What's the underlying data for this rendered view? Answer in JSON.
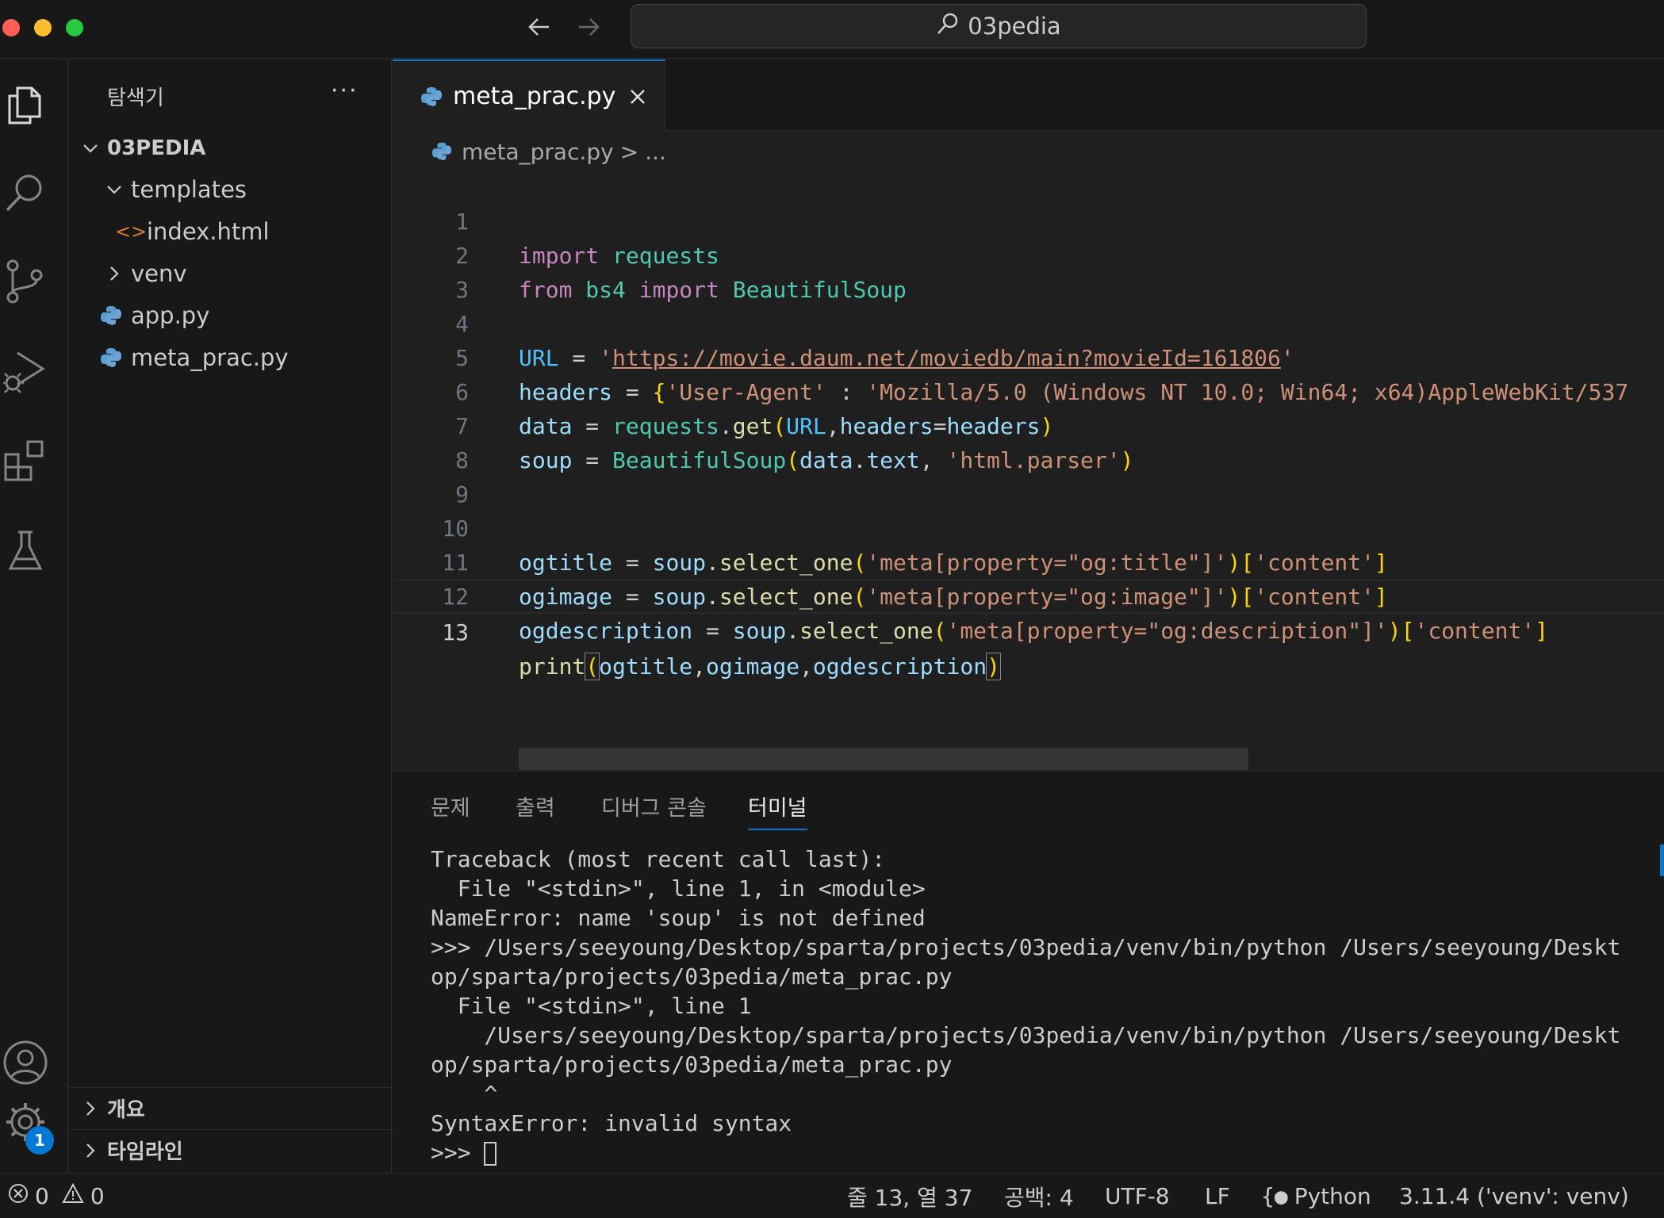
{
  "titlebar": {
    "search_text": "03pedia"
  },
  "sidebar": {
    "title": "탐색기",
    "more": "···",
    "root": "03PEDIA",
    "items": [
      {
        "label": "templates"
      },
      {
        "label": "index.html",
        "icon_text": "<>"
      },
      {
        "label": "venv"
      },
      {
        "label": "app.py"
      },
      {
        "label": "meta_prac.py"
      }
    ],
    "sections": [
      {
        "label": "개요"
      },
      {
        "label": "타임라인"
      }
    ]
  },
  "activity": {
    "badge": "1"
  },
  "editor": {
    "tab_label": "meta_prac.py",
    "breadcrumb_file": "meta_prac.py",
    "breadcrumb_sep": ">",
    "breadcrumb_more": "...",
    "line_numbers": [
      "1",
      "2",
      "3",
      "4",
      "5",
      "6",
      "7",
      "8",
      "9",
      "10",
      "11",
      "12",
      "13"
    ],
    "code_lines": [
      "import requests",
      "from bs4 import BeautifulSoup",
      "",
      "URL = 'https://movie.daum.net/moviedb/main?movieId=161806'",
      "headers = {'User-Agent' : 'Mozilla/5.0 (Windows NT 10.0; Win64; x64)AppleWebKit/537",
      "data = requests.get(URL,headers=headers)",
      "soup = BeautifulSoup(data.text, 'html.parser')",
      "",
      "",
      "ogtitle = soup.select_one('meta[property=\"og:title\"]')['content']",
      "ogimage = soup.select_one('meta[property=\"og:image\"]')['content']",
      "ogdescription = soup.select_one('meta[property=\"og:description\"]')['content']",
      "print(ogtitle,ogimage,ogdescription)"
    ]
  },
  "panel": {
    "tabs": [
      "문제",
      "출력",
      "디버그 콘솔",
      "터미널"
    ],
    "active_tab": "터미널",
    "terminal_lines": [
      "Traceback (most recent call last):",
      "  File \"<stdin>\", line 1, in <module>",
      "NameError: name 'soup' is not defined",
      ">>> /Users/seeyoung/Desktop/sparta/projects/03pedia/venv/bin/python /Users/seeyoung/Deskt",
      "op/sparta/projects/03pedia/meta_prac.py",
      "  File \"<stdin>\", line 1",
      "    /Users/seeyoung/Desktop/sparta/projects/03pedia/venv/bin/python /Users/seeyoung/Deskt",
      "op/sparta/projects/03pedia/meta_prac.py",
      "    ^",
      "SyntaxError: invalid syntax"
    ],
    "prompt": ">>> "
  },
  "statusbar": {
    "errors": "0",
    "warnings": "0",
    "position": "줄 13, 열 37",
    "spaces": "공백: 4",
    "encoding": "UTF-8",
    "eol": "LF",
    "language": "Python",
    "interpreter": "3.11.4 ('venv': venv)"
  },
  "colors": {
    "accent": "#0078d4",
    "background": "#1f1f1f",
    "sidebar": "#181818"
  }
}
